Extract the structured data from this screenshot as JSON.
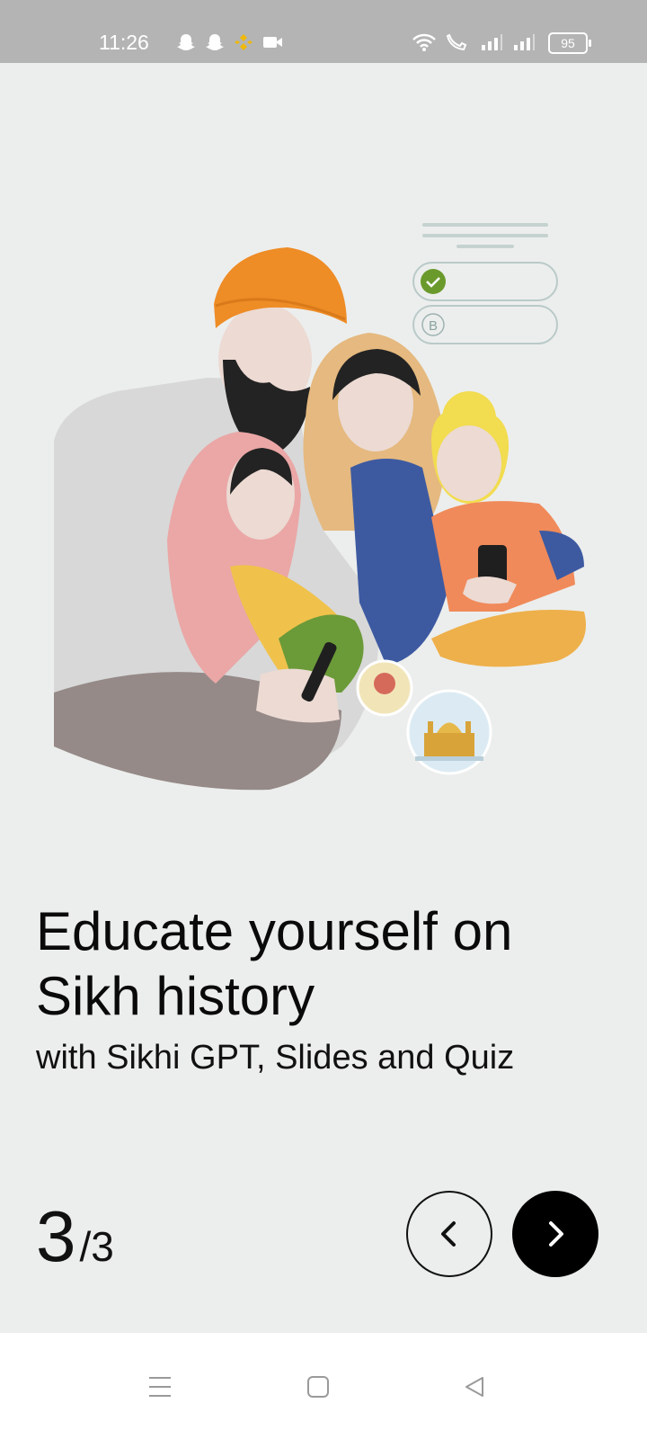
{
  "status_bar": {
    "time": "11:26",
    "battery": "95",
    "left_icons": [
      "snapchat-icon",
      "snapchat-icon",
      "binance-icon",
      "video-camera-icon"
    ],
    "right_icons": [
      "wifi-icon",
      "volte-call-icon",
      "signal-icon",
      "signal-icon"
    ]
  },
  "onboarding": {
    "title": "Educate yourself on Sikh history",
    "subtitle": "with Sikhi GPT, Slides and Quiz",
    "page_current": "3",
    "page_total": "/3",
    "quiz_option_b": "B"
  },
  "nav": {
    "prev_icon": "chevron-left-icon",
    "next_icon": "chevron-right-icon"
  },
  "system_nav": [
    "menu-icon",
    "home-icon",
    "back-icon"
  ],
  "colors": {
    "background": "#eceeed",
    "status_bar": "#b3b4b3",
    "turban": "#ee8c26",
    "accent_check": "#6a9a2c",
    "button_dark": "#000000"
  }
}
